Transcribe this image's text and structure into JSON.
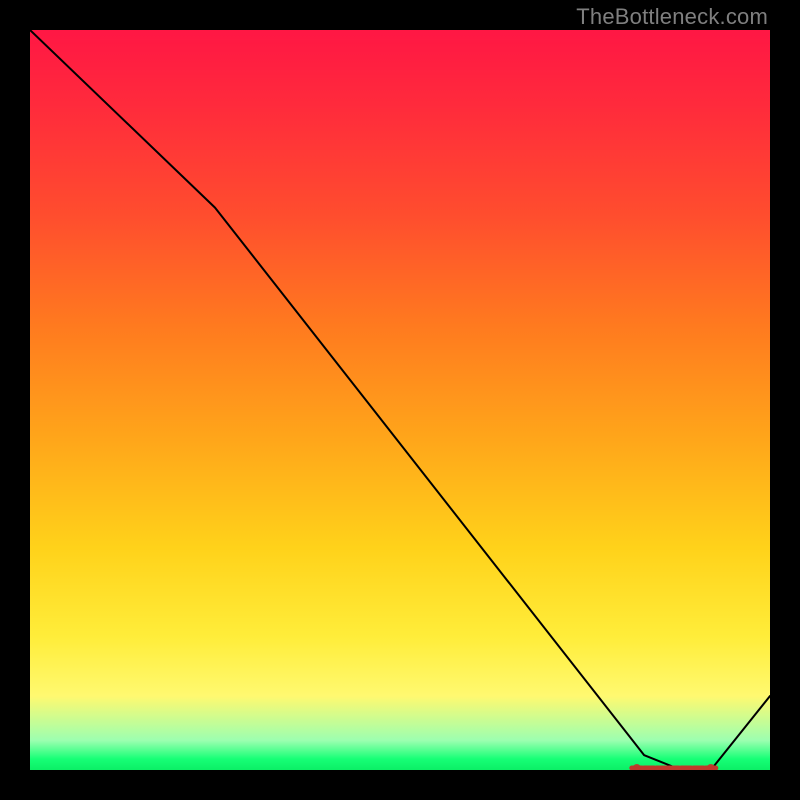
{
  "watermark": "TheBottleneck.com",
  "colors": {
    "frame": "#000000",
    "watermark": "#7f7f7f",
    "curve": "#000000",
    "marker": "#c0392b",
    "gradient_stops": [
      "#ff1744",
      "#ff7a1f",
      "#ffd21a",
      "#fff970",
      "#17ff76"
    ]
  },
  "chart_data": {
    "type": "line",
    "x": [
      0,
      25,
      83,
      88,
      92,
      100
    ],
    "values": [
      100,
      76,
      2,
      0,
      0,
      10
    ],
    "title": "",
    "xlabel": "",
    "ylabel": "",
    "xlim": [
      0,
      100
    ],
    "ylim": [
      0,
      100
    ],
    "annotations": {
      "optimal_zone_x": [
        82,
        92
      ],
      "marker_style": "red-dashes-at-curve-minimum"
    }
  }
}
